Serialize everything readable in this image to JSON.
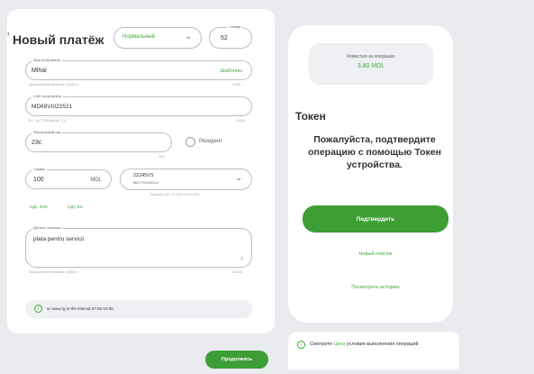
{
  "payment": {
    "title": "Новый платёж",
    "type_value": "Нормальный",
    "number_label": "Номер",
    "number_value": "52",
    "name_label": "Имя получателя",
    "name_value": "Mihai",
    "templates_link": "Шаблоны",
    "name_hint": "Запрещённые символы: !@#$ и т",
    "name_count": "11/35",
    "account_label": "Счёт получателя",
    "account_value": "MD69VI022521",
    "account_hint": "B.C. VICTORIABANK S.A.",
    "account_bic": "SAQA",
    "fiscal_label": "Фискальный код",
    "fiscal_value": "23c",
    "fiscal_count": "3/20",
    "resident_label": "Резидент",
    "amount_label": "Сумма",
    "amount_value": "100",
    "currency": "MDL",
    "debit_account_line1": "22245VS",
    "debit_account_line2": "MD77VI022224",
    "debit_hint": "Текущий счёт: 23 455 750.80 MDL",
    "vat_20": "НДС 20%",
    "vat_8": "НДС 8%",
    "details_label": "Детали платежа",
    "details_value": "plata pentru servicii",
    "details_hint": "Запрещённые символы: !@#$ и т",
    "details_count": "21/105",
    "info_text": "ко www.rg in the interval 07:00-19:30",
    "continue_button": "Продолжить"
  },
  "token": {
    "commission_label": "Комиссия за операцию",
    "commission_value": "3.80 MDL",
    "heading": "Токен",
    "message": "Пожалуйста, подтвердите операцию с помощью Токен устройства.",
    "confirm_button": "Подтвердить",
    "new_payment_link": "Новый платёж",
    "history_link": "Посмотреть историю"
  },
  "note": {
    "prefix": "Смотрите",
    "link": "Ценэ",
    "suffix": "условия выполнения операций"
  },
  "colors": {
    "accent": "#3d9e36",
    "page_bg": "#e9ebee"
  }
}
